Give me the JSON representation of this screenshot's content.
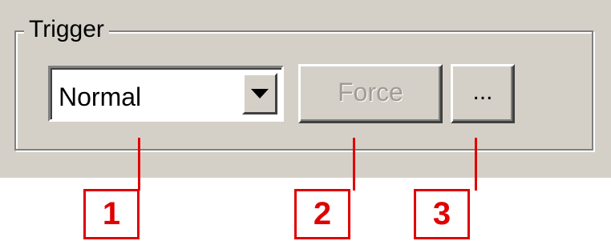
{
  "group": {
    "title": "Trigger"
  },
  "mode_combo": {
    "value": "Normal"
  },
  "buttons": {
    "force_label": "Force",
    "more_label": "..."
  },
  "callouts": [
    "1",
    "2",
    "3"
  ],
  "colors": {
    "panel_bg": "#d4d0c8",
    "callout": "#e00000",
    "disabled_text": "#a09c94"
  }
}
